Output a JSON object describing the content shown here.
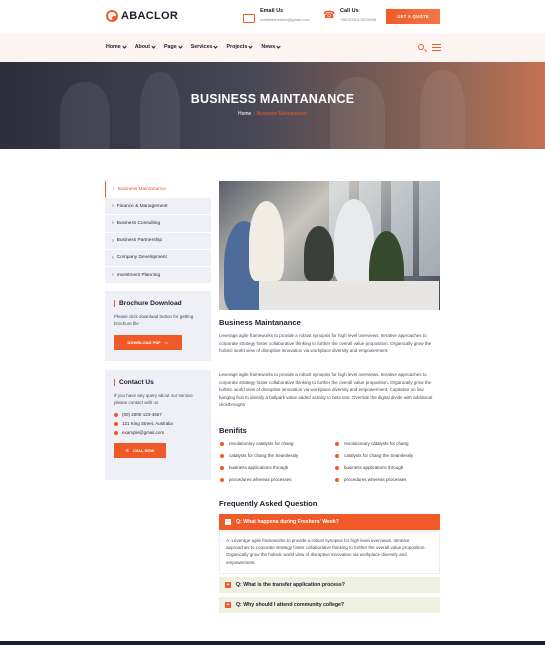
{
  "header": {
    "logo": "ABACLOR",
    "email_label": "Email Us",
    "email_value": "realtimethemes@gmail.com",
    "call_label": "Call Us",
    "call_value": "+88-00024-5678908",
    "quote_button": "GET A QUOTE"
  },
  "nav": {
    "items": [
      "Home",
      "About",
      "Page",
      "Services",
      "Projects",
      "News"
    ]
  },
  "banner": {
    "title": "BUSINESS MAINTANANCE",
    "crumb_home": "Home",
    "crumb_sep": "/",
    "crumb_current": "Business Maintanance"
  },
  "sidebar": {
    "items": [
      "Business Maintanance",
      "Finance & Management",
      "Business Consulting",
      "Business Partnership",
      "Company Development",
      "Investment Planning"
    ],
    "brochure_title": "Brochure Download",
    "brochure_text": "Please click download button for getting brochure file",
    "brochure_button": "DOWNLOAD PDF",
    "contact_title": "Contact Us",
    "contact_text": "If you have any query about our service please contact with us",
    "contact_phone": "(00) 2500-123-4567",
    "contact_address": "121 King Street, Australia",
    "contact_email": "example@gmail.com",
    "call_button": "CALL NOW"
  },
  "main": {
    "title": "Business Maintanance",
    "para1": "Leverage agile frameworks to provide a robust synopsis for high level overviews. Iterative approaches to corporate strategy foster collaborative thinking to further the overall value proposition. Organically grow the holistic world view of disruptive innovation via workplace diversity and empowerment.",
    "para2": "Leverage agile frameworks to provide a robust synopsis for high level overviews. Iterative approaches to corporate strategy foster collaborative thinking to further the overall value proposition. Organically grow the holistic world view of disruptive innovation via workplace diversity and empowerment. Capitalize on low hanging fruit to identify a ballpark value added activity to beta test. Override the digital divide with additional clickthroughs",
    "benefits_title": "Benifits",
    "benefits": [
      "revolutionary catalysts for chang",
      "catalysts for chang the Seamlessly",
      "business applications through",
      "procedures whereas processes",
      "revolutionary catalysts for chang",
      "catalysts for chang the Seamlessly",
      "business applications through",
      "procedures whereas processes"
    ],
    "faq_title": "Frequently Asked Question",
    "faq": [
      {
        "q": "Q: What happens during Freshers' Week?",
        "toggle": "−"
      },
      {
        "q": "Q: What is the transfer application process?",
        "toggle": "+"
      },
      {
        "q": "Q: Why should I attend community college?",
        "toggle": "+"
      }
    ],
    "faq_answer": "A: Leverage agile frameworks to provide a robust synopsis for high level overviews. Iterative approaches to corporate strategy foster collaborative thinking to further the overall value proposition. Organically grow the holistic world view of disruptive innovation via workplace diversity and empowerment."
  },
  "colors": {
    "accent": "#f05a28",
    "dark": "#1d1d2c",
    "sidebar_bg": "#eef0f6"
  }
}
